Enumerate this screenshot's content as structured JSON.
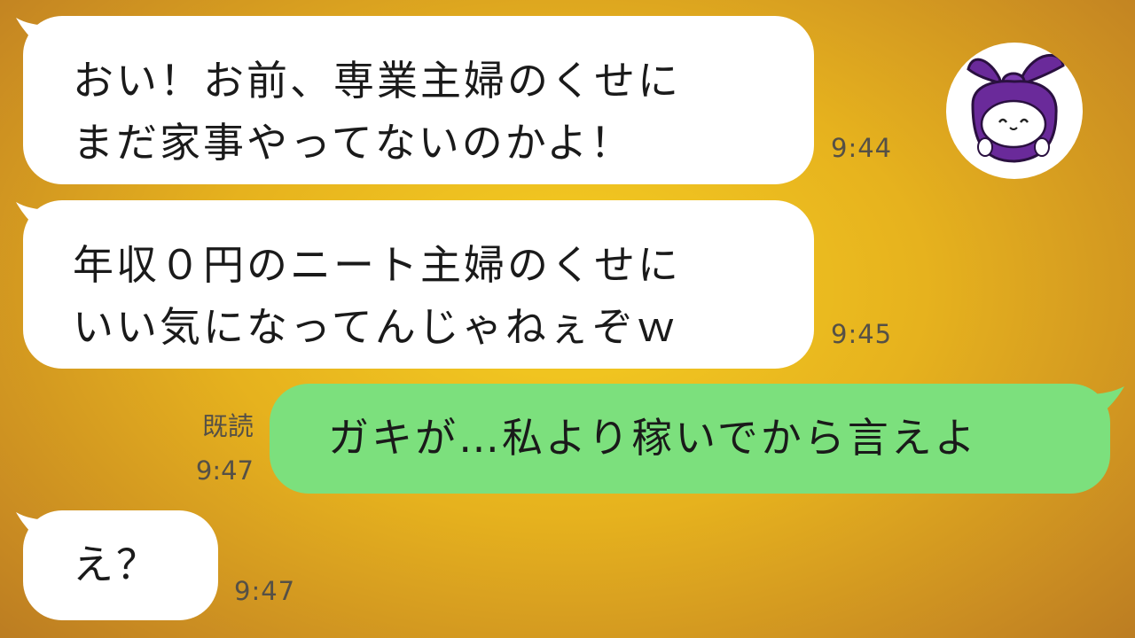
{
  "chat": {
    "messages": [
      {
        "side": "left",
        "lines": [
          "おい！お前、専業主婦のくせに",
          "まだ家事やってないのかよ！"
        ],
        "time": "9:44"
      },
      {
        "side": "left",
        "lines": [
          "年収０円のニート主婦のくせに",
          "いい気になってんじゃねぇぞｗ"
        ],
        "time": "9:45"
      },
      {
        "side": "right",
        "lines": [
          "ガキが…私より稼いでから言えよ"
        ],
        "read": "既読",
        "time": "9:47"
      },
      {
        "side": "left",
        "lines": [
          "え？"
        ],
        "time": "9:47"
      }
    ]
  },
  "avatar": {
    "icon": "purple-furoshiki-character-icon"
  },
  "colors": {
    "background": "#e6b21e",
    "incoming_bubble": "#ffffff",
    "outgoing_bubble": "#7ce07d",
    "avatar_purple": "#6a2a9a"
  }
}
